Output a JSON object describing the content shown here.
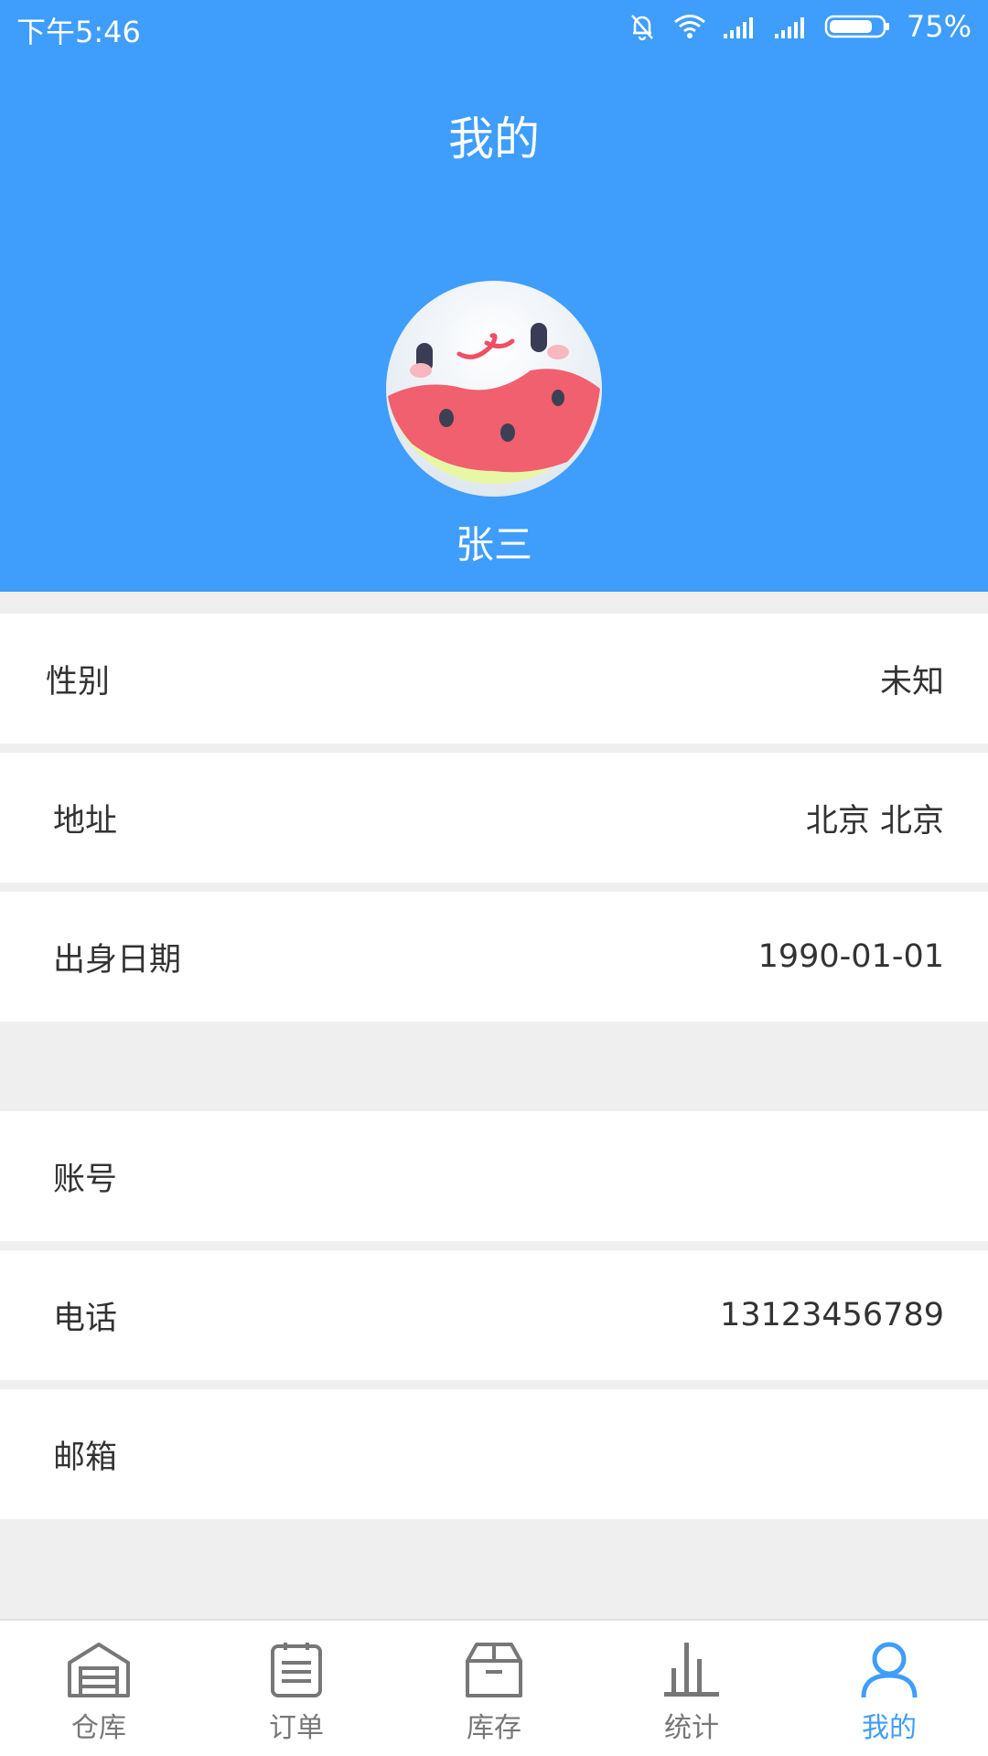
{
  "status_bar": {
    "time": "下午5:46",
    "battery": "75%",
    "icons": [
      "bell-off-icon",
      "wifi-icon",
      "signal-icon",
      "signal-icon",
      "battery-icon"
    ]
  },
  "header": {
    "title": "我的",
    "user_name": "张三",
    "background_color": "#3f9dfb"
  },
  "profile": {
    "gender": {
      "label": "性别",
      "value": "未知"
    },
    "address": {
      "label": "地址",
      "value": "北京 北京"
    },
    "birthday": {
      "label": "出身日期",
      "value": "1990-01-01"
    },
    "account": {
      "label": "账号",
      "value": ""
    },
    "phone": {
      "label": "电话",
      "value": "13123456789"
    },
    "email": {
      "label": "邮箱",
      "value": ""
    }
  },
  "tabbar": {
    "accent_color": "#3f9dfb",
    "items": [
      {
        "label": "仓库",
        "icon": "warehouse-icon",
        "active": false
      },
      {
        "label": "订单",
        "icon": "order-list-icon",
        "active": false
      },
      {
        "label": "库存",
        "icon": "box-icon",
        "active": false
      },
      {
        "label": "统计",
        "icon": "bar-chart-icon",
        "active": false
      },
      {
        "label": "我的",
        "icon": "user-icon",
        "active": true
      }
    ]
  }
}
